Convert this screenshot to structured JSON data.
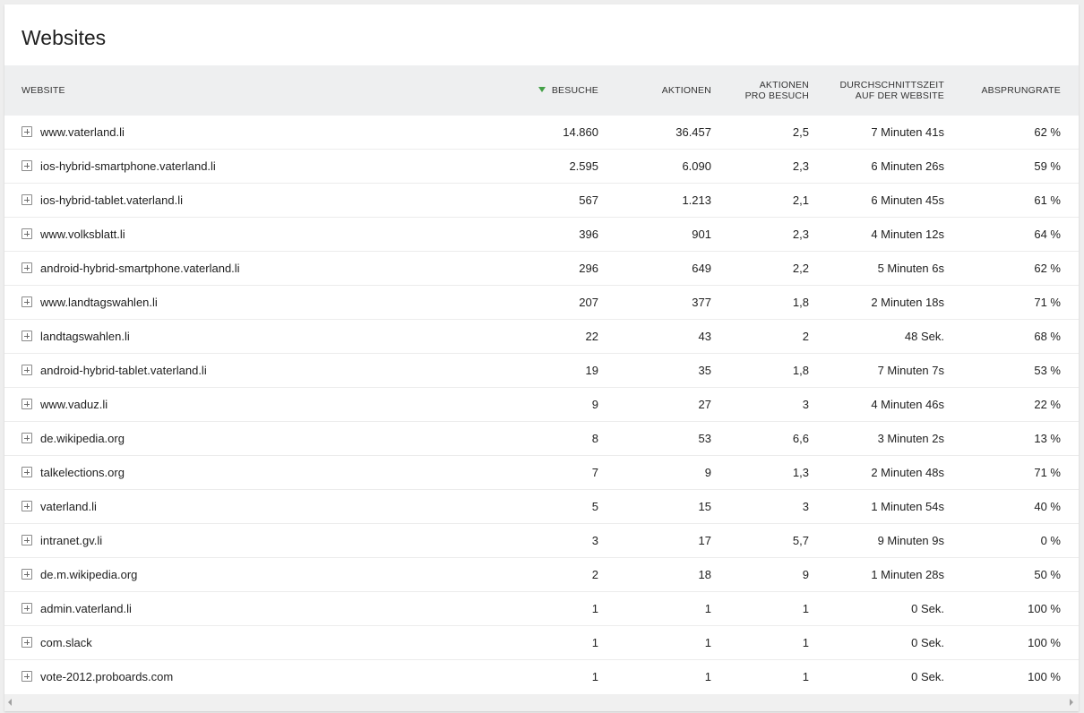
{
  "title": "Websites",
  "columns": {
    "website": "Website",
    "visits": "Besuche",
    "actions": "Aktionen",
    "actions_per_visit_1": "Aktionen",
    "actions_per_visit_2": "pro Besuch",
    "avg_time_1": "Durchschnittszeit",
    "avg_time_2": "auf der Website",
    "bounce": "Absprungrate"
  },
  "sort": {
    "column": "visits",
    "direction": "desc",
    "indicator_color": "#43a047"
  },
  "rows": [
    {
      "site": "www.vaterland.li",
      "visits": "14.860",
      "actions": "36.457",
      "apv": "2,5",
      "avg": "7 Minuten 41s",
      "bounce": "62 %"
    },
    {
      "site": "ios-hybrid-smartphone.vaterland.li",
      "visits": "2.595",
      "actions": "6.090",
      "apv": "2,3",
      "avg": "6 Minuten 26s",
      "bounce": "59 %"
    },
    {
      "site": "ios-hybrid-tablet.vaterland.li",
      "visits": "567",
      "actions": "1.213",
      "apv": "2,1",
      "avg": "6 Minuten 45s",
      "bounce": "61 %"
    },
    {
      "site": "www.volksblatt.li",
      "visits": "396",
      "actions": "901",
      "apv": "2,3",
      "avg": "4 Minuten 12s",
      "bounce": "64 %"
    },
    {
      "site": "android-hybrid-smartphone.vaterland.li",
      "visits": "296",
      "actions": "649",
      "apv": "2,2",
      "avg": "5 Minuten 6s",
      "bounce": "62 %"
    },
    {
      "site": "www.landtagswahlen.li",
      "visits": "207",
      "actions": "377",
      "apv": "1,8",
      "avg": "2 Minuten 18s",
      "bounce": "71 %"
    },
    {
      "site": "landtagswahlen.li",
      "visits": "22",
      "actions": "43",
      "apv": "2",
      "avg": "48 Sek.",
      "bounce": "68 %"
    },
    {
      "site": "android-hybrid-tablet.vaterland.li",
      "visits": "19",
      "actions": "35",
      "apv": "1,8",
      "avg": "7 Minuten 7s",
      "bounce": "53 %"
    },
    {
      "site": "www.vaduz.li",
      "visits": "9",
      "actions": "27",
      "apv": "3",
      "avg": "4 Minuten 46s",
      "bounce": "22 %"
    },
    {
      "site": "de.wikipedia.org",
      "visits": "8",
      "actions": "53",
      "apv": "6,6",
      "avg": "3 Minuten 2s",
      "bounce": "13 %"
    },
    {
      "site": "talkelections.org",
      "visits": "7",
      "actions": "9",
      "apv": "1,3",
      "avg": "2 Minuten 48s",
      "bounce": "71 %"
    },
    {
      "site": "vaterland.li",
      "visits": "5",
      "actions": "15",
      "apv": "3",
      "avg": "1 Minuten 54s",
      "bounce": "40 %"
    },
    {
      "site": "intranet.gv.li",
      "visits": "3",
      "actions": "17",
      "apv": "5,7",
      "avg": "9 Minuten 9s",
      "bounce": "0 %"
    },
    {
      "site": "de.m.wikipedia.org",
      "visits": "2",
      "actions": "18",
      "apv": "9",
      "avg": "1 Minuten 28s",
      "bounce": "50 %"
    },
    {
      "site": "admin.vaterland.li",
      "visits": "1",
      "actions": "1",
      "apv": "1",
      "avg": "0 Sek.",
      "bounce": "100 %"
    },
    {
      "site": "com.slack",
      "visits": "1",
      "actions": "1",
      "apv": "1",
      "avg": "0 Sek.",
      "bounce": "100 %"
    },
    {
      "site": "vote-2012.proboards.com",
      "visits": "1",
      "actions": "1",
      "apv": "1",
      "avg": "0 Sek.",
      "bounce": "100 %"
    }
  ],
  "icons": {
    "row_expand": "plus-square-icon",
    "scroll_left": "scroll-left-arrow-icon",
    "scroll_right": "scroll-right-arrow-icon"
  }
}
